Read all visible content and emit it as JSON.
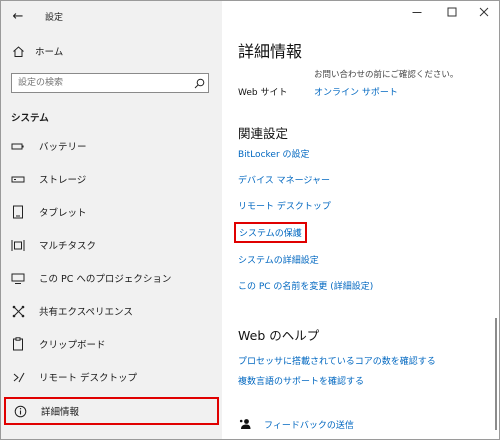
{
  "window": {
    "title": "設定"
  },
  "nav": {
    "home_label": "ホーム",
    "search_placeholder": "設定の検索",
    "section_title": "システム",
    "items": [
      {
        "label": "バッテリー",
        "icon": "battery-icon"
      },
      {
        "label": "ストレージ",
        "icon": "storage-icon"
      },
      {
        "label": "タブレット",
        "icon": "tablet-icon"
      },
      {
        "label": "マルチタスク",
        "icon": "multitask-icon"
      },
      {
        "label": "この PC へのプロジェクション",
        "icon": "projection-icon"
      },
      {
        "label": "共有エクスペリエンス",
        "icon": "shared-experience-icon"
      },
      {
        "label": "クリップボード",
        "icon": "clipboard-icon"
      },
      {
        "label": "リモート デスクトップ",
        "icon": "remote-desktop-icon"
      },
      {
        "label": "詳細情報",
        "icon": "info-icon",
        "selected": true
      }
    ]
  },
  "main": {
    "title": "詳細情報",
    "clipped_text": "お問い合わせの前にご確認ください。",
    "web_site_label": "Web サイト",
    "web_site_link": "オンライン サポート",
    "related_title": "関連設定",
    "related_links": [
      "BitLocker の設定",
      "デバイス マネージャー",
      "リモート デスクトップ",
      "システムの保護",
      "システムの詳細設定",
      "この PC の名前を変更 (詳細設定)"
    ],
    "highlighted_link": "システムの保護",
    "web_help_title": "Web のヘルプ",
    "web_help_links": [
      "プロセッサに搭載されているコアの数を確認する",
      "複数言語のサポートを確認する"
    ],
    "feedback_label": "フィードバックの送信"
  },
  "colors": {
    "accent_link": "#0067c0",
    "highlight_box": "#e00000",
    "nav_bg": "#f1f1f1"
  }
}
